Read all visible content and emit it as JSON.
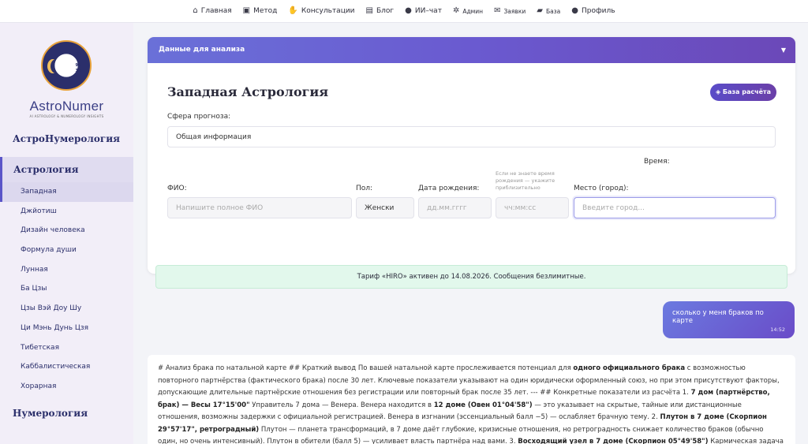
{
  "topnav": {
    "items": [
      {
        "label": "Главная",
        "icon": "home-icon",
        "glyph": "⌂"
      },
      {
        "label": "Метод",
        "icon": "book-icon",
        "glyph": "▣"
      },
      {
        "label": "Консультации",
        "icon": "handshake-icon",
        "glyph": "✋"
      },
      {
        "label": "Блог",
        "icon": "newspaper-icon",
        "glyph": "▤"
      },
      {
        "label": "ИИ–чат",
        "icon": "chat-icon",
        "glyph": "●"
      },
      {
        "label": "Админ",
        "icon": "gear-icon",
        "glyph": "✲"
      },
      {
        "label": "Заявки",
        "icon": "envelope-icon",
        "glyph": "✉"
      },
      {
        "label": "База",
        "icon": "folder-icon",
        "glyph": "▰"
      },
      {
        "label": "Профиль",
        "icon": "user-icon",
        "glyph": "●"
      }
    ]
  },
  "logo": {
    "title": "AstroNumer",
    "subtitle": "AI ASTROLOGY & NUMEROLOGY INSIGHTS",
    "numbers": [
      "23",
      "4",
      "95",
      "33"
    ]
  },
  "sidebar": {
    "brand_heading": "АстроНумерология",
    "astrology_heading": "Астрология",
    "astrology_items": [
      "Западная",
      "Джйотиш",
      "Дизайн человека",
      "Формула души",
      "Лунная",
      "Ба Цзы",
      "Цзы Вэй Доу Шу",
      "Ци Мэнь Дунь Цзя",
      "Тибетская",
      "Каббалистическая",
      "Хорарная"
    ],
    "active_index": 0,
    "numerology_heading": "Нумерология"
  },
  "card": {
    "header": "Данные для анализа",
    "toggle": "▼",
    "title": "Западная Астрология",
    "base_button": "База расчёта",
    "sphere_label": "Сфера прогноза:",
    "sphere_value": "Общая информация",
    "fio_label": "ФИО:",
    "fio_placeholder": "Напишите полное ФИО",
    "gender_label": "Пол:",
    "gender_value": "Женски",
    "birth_label": "Дата рождения:",
    "birth_placeholder": "дд.мм.гггг",
    "time_label": "Время:",
    "time_hint": "Если не знаете время рождения — укажите приблизительно",
    "time_placeholder": "чч:мм:сс",
    "place_label": "Место (город):",
    "place_placeholder": "Введите город..."
  },
  "tariff": {
    "text": "Тариф «HIRO» активен до 14.08.2026. Сообщения безлимитные."
  },
  "chat": {
    "user_message": "сколько у меня браков по карте",
    "user_time": "14:52",
    "bot_parts": [
      {
        "t": "# Анализ брака по натальной карте ## Краткий вывод По вашей натальной карте прослеживается потенциал для ",
        "b": false
      },
      {
        "t": "одного официального брака",
        "b": true
      },
      {
        "t": " с возможностью повторного партнёрства (фактического брака) после 30 лет. Ключевые показатели указывают на один юридически оформленный союз, но при этом присутствуют факторы, допускающие длительные партнёрские отношения без регистрации или повторный брак после 35 лет. --- ## Конкретные показатели из расчёта 1. ",
        "b": false
      },
      {
        "t": "7 дом (партнёрство, брак) — Весы 17°15'00\"",
        "b": true
      },
      {
        "t": " Управитель 7 дома — Венера. Венера находится в ",
        "b": false
      },
      {
        "t": "12 доме (Овен 01°04'58\")",
        "b": true
      },
      {
        "t": " — это указывает на скрытые, тайные или дистанционные отношения, возможны задержки с официальной регистрацией. Венера в изгнании (эссенциальный балл −5) — ослабляет брачную тему. 2. ",
        "b": false
      },
      {
        "t": "Плутон в 7 доме (Скорпион 29°57'17\", ретроградный)",
        "b": true
      },
      {
        "t": " Плутон — планета трансформаций, в 7 доме даёт глубокие, кризисные отношения, но ретроградность снижает количество браков (обычно один, но очень интенсивный). Плутон в обители (балл 5) — усиливает власть партнёра над вами. 3. ",
        "b": false
      },
      {
        "t": "Восходящий узел в 7 доме (Скорпион 05°49'58\")",
        "b": true
      },
      {
        "t": " Кармическая задача — через партнёрство. Это указывает на",
        "b": false
      }
    ]
  },
  "colors": {
    "accent": "#5a55c8",
    "header_gradient_start": "#6a70d8",
    "header_gradient_end": "#6b48b8",
    "tariff_bg": "#e2f8ec"
  }
}
